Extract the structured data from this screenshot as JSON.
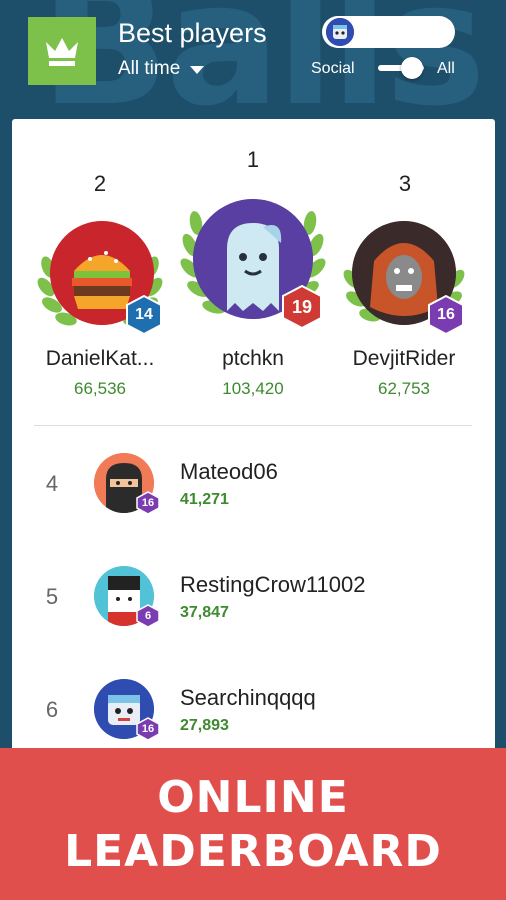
{
  "header": {
    "background_word": "Balls",
    "title": "Best players",
    "filter_label": "All time",
    "toggle_left": "Social",
    "toggle_right": "All"
  },
  "podium": [
    {
      "rank": "2",
      "name": "DanielKat...",
      "score": "66,536",
      "level": "14",
      "badge_color": "#1f6fb0"
    },
    {
      "rank": "1",
      "name": "ptchkn",
      "score": "103,420",
      "level": "19",
      "badge_color": "#cf3a34"
    },
    {
      "rank": "3",
      "name": "DevjitRider",
      "score": "62,753",
      "level": "16",
      "badge_color": "#7a3cb0"
    }
  ],
  "list": [
    {
      "rank": "4",
      "name": "Mateod06",
      "score": "41,271",
      "level": "16"
    },
    {
      "rank": "5",
      "name": "RestingCrow11002",
      "score": "37,847",
      "level": "6"
    },
    {
      "rank": "6",
      "name": "Searchinqqqq",
      "score": "27,893",
      "level": "16"
    }
  ],
  "banner": {
    "line1": "ONLINE",
    "line2": "LEADERBOARD"
  },
  "colors": {
    "background": "#1d4f6b",
    "accent_green": "#7dc14a",
    "score_green": "#3d8a2f",
    "banner_red": "#e04f4c"
  }
}
